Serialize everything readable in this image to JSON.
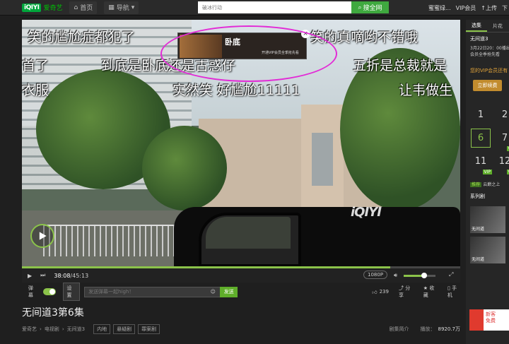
{
  "header": {
    "logo_mark": "iQIYI",
    "logo_name": "爱奇艺",
    "home_label": "首页",
    "nav_label": "导航",
    "search_placeholder": "破冰行动",
    "search_button": "搜全网",
    "user": "蜜蜜绿...",
    "vip_label": "VIP会员",
    "upload_label": "上传",
    "download_label": "下"
  },
  "player": {
    "danmaku": [
      "笑的尴尬症都犯了",
      "笑的真嘀哟不错哦",
      "首了",
      "到底是卧底还是古惑仔",
      "五折是总裁就是",
      "衣服",
      "实然笑 好尴尬11111",
      "让韦做生"
    ],
    "watermark": "iQIYI",
    "ad": {
      "title": "卧底",
      "subtitle": "开通VIP会员全季抢先看"
    },
    "progress_fraction": 0.84
  },
  "controls": {
    "current_time": "38:08",
    "separator": " / ",
    "total_time": "45:13",
    "quality": "1080P",
    "volume_fraction": 0.65
  },
  "danmaku_bar": {
    "label": "弹幕",
    "settings": "设置",
    "input_placeholder": "发送弹幕一起high！",
    "send": "发送",
    "likes": "239",
    "share": "分享",
    "collect": "收藏",
    "mobile": "手机"
  },
  "episode": {
    "title": "无间道3第6集",
    "breadcrumb_site": "爱奇艺",
    "breadcrumb_cat": "电视剧",
    "breadcrumb_show": "无间道3",
    "tags": [
      "内地",
      "悬疑剧",
      "罪案剧"
    ],
    "intro": "剧集简介",
    "plays_label": "播放：",
    "plays": "8920.7万"
  },
  "sidebar": {
    "tab_episodes": "选集",
    "tab_clips": "片花",
    "show": "无间道3",
    "update": "3月22日20：00播出",
    "vip_note": "会员全季抢先看",
    "vip_prompt": "您的VIP会员还有",
    "vip_button": "立即续费",
    "episodes": [
      {
        "num": "1",
        "vip": false,
        "current": false
      },
      {
        "num": "2",
        "vip": false,
        "current": false
      },
      {
        "num": "6",
        "vip": false,
        "current": true
      },
      {
        "num": "7",
        "vip": true,
        "current": false
      },
      {
        "num": "11",
        "vip": true,
        "current": false
      },
      {
        "num": "12",
        "vip": true,
        "current": false
      }
    ],
    "vip_tag": "VIP",
    "recommend_tag": "推荐",
    "recommend_text": "云巅之上",
    "series_label": "系列剧",
    "thumb1": "无间道",
    "thumb2": "无间道"
  },
  "redpack": {
    "line1": "新客",
    "line2": "免费"
  }
}
